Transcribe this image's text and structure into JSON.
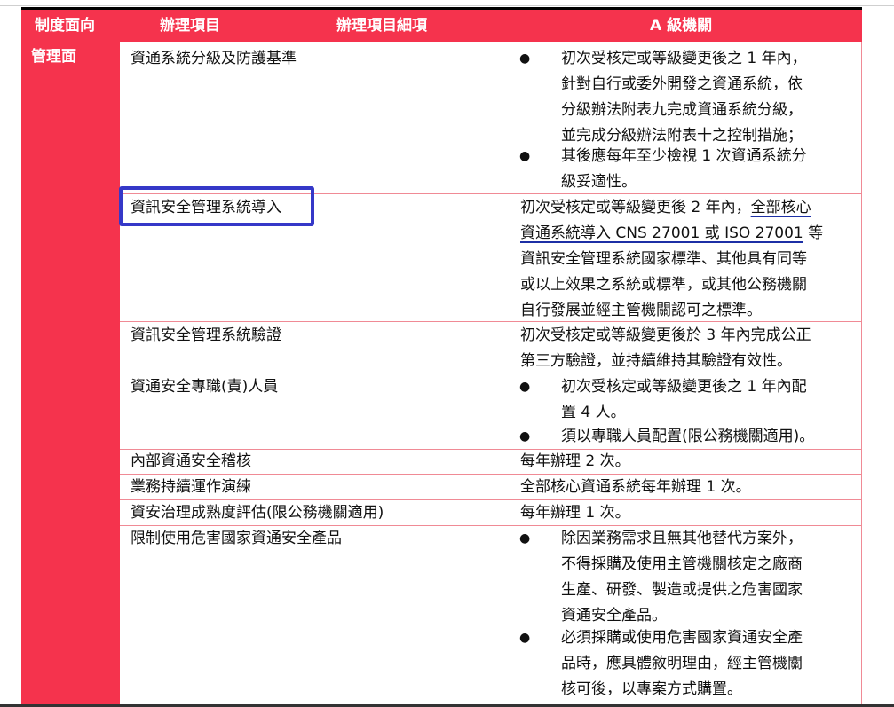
{
  "header": {
    "col_aspect": "制度面向",
    "col_item": "辦理項目",
    "col_detail": "辦理項目細項",
    "col_level": "A 級機關"
  },
  "aspect": "管理面",
  "rows": [
    {
      "item": "資通系統分級及防護基準",
      "bullets": [
        [
          "初次受核定或等級變更後之 1 年內，",
          "針對自行或委外開發之資通系統，依",
          "分級辦法附表九完成資通系統分級，",
          "並完成分級辦法附表十之控制措施；"
        ],
        [
          "其後應每年至少檢視 1 次資通系統分",
          "級妥適性。"
        ]
      ]
    },
    {
      "item": "資訊安全管理系統導入",
      "text_a": "初次受核定或等級變更後 2 年內，",
      "text_b": "全部核心",
      "text_c": "資通系統導入 CNS 27001 或 ISO 27001",
      "text_d": "等",
      "lines": [
        "資訊安全管理系統國家標準、其他具有同等",
        "或以上效果之系統或標準，或其他公務機關",
        "自行發展並經主管機關認可之標準。"
      ]
    },
    {
      "item": "資訊安全管理系統驗證",
      "lines": [
        "初次受核定或等級變更後於 3 年內完成公正",
        "第三方驗證，並持續維持其驗證有效性。"
      ]
    },
    {
      "item": "資通安全專職(責)人員",
      "bullets": [
        [
          "初次受核定或等級變更後之 1 年內配",
          "置 4 人。"
        ],
        [
          "須以專職人員配置(限公務機關適用)。"
        ]
      ]
    },
    {
      "item": "內部資通安全稽核",
      "lines": [
        "每年辦理 2 次。"
      ]
    },
    {
      "item": "業務持續運作演練",
      "lines": [
        "全部核心資通系統每年辦理 1 次。"
      ]
    },
    {
      "item": "資安治理成熟度評估(限公務機關適用)",
      "lines": [
        "每年辦理 1 次。"
      ]
    },
    {
      "item": "限制使用危害國家資通安全產品",
      "bullets": [
        [
          "除因業務需求且無其他替代方案外，",
          "不得採購及使用主管機關核定之廠商",
          "生產、研發、製造或提供之危害國家",
          "資通安全產品。"
        ],
        [
          "必須採購或使用危害國家資通安全產",
          "品時，應具體敘明理由，經主管機關",
          "核可後，以專案方式購置。"
        ]
      ]
    }
  ],
  "bullet_char": "●"
}
